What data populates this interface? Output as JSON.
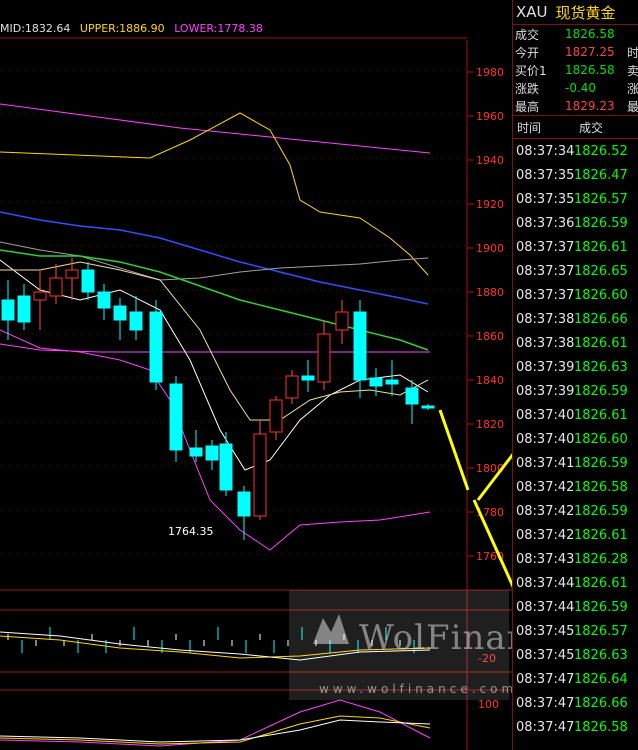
{
  "indicator": {
    "mid": "MID:1832.64",
    "upper": "UPPER:1886.90",
    "lower": "LOWER:1778.38",
    "colors": {
      "mid": "#e0e0e0",
      "upper": "#ffd700",
      "lower": "#ff40ff"
    }
  },
  "price_axis": {
    "ticks": [
      "1980",
      "1960",
      "1940",
      "1920",
      "1900",
      "1880",
      "1860",
      "1840",
      "1820",
      "1800",
      "1780",
      "1760"
    ],
    "color": "#ff3030"
  },
  "lower_axis": {
    "ticks": [
      "-20",
      "100"
    ]
  },
  "annotation": {
    "low_label": "1764.35"
  },
  "watermark": {
    "brand": "WolFinance",
    "url": "www.wolfinance.com"
  },
  "quote": {
    "code": "XAU",
    "name": "现货黄金",
    "rows": [
      {
        "label": "成交",
        "value": "1826.58",
        "color": "#00e000",
        "extra": ""
      },
      {
        "label": "今开",
        "value": "1827.25",
        "color": "#ff4040",
        "extra": "时"
      },
      {
        "label": "买价1",
        "value": "1826.58",
        "color": "#00e000",
        "extra": "卖"
      },
      {
        "label": "涨跌",
        "value": "-0.40",
        "color": "#00e000",
        "extra": "涨"
      },
      {
        "label": "最高",
        "value": "1829.23",
        "color": "#ff4040",
        "extra": "最"
      }
    ]
  },
  "ticks_header": {
    "time": "时间",
    "price": "成交"
  },
  "ticks": [
    {
      "time": "08:37:34",
      "price": "1826.52"
    },
    {
      "time": "08:37:35",
      "price": "1826.47"
    },
    {
      "time": "08:37:35",
      "price": "1826.57"
    },
    {
      "time": "08:37:36",
      "price": "1826.59"
    },
    {
      "time": "08:37:37",
      "price": "1826.61"
    },
    {
      "time": "08:37:37",
      "price": "1826.65"
    },
    {
      "time": "08:37:37",
      "price": "1826.60"
    },
    {
      "time": "08:37:38",
      "price": "1826.66"
    },
    {
      "time": "08:37:38",
      "price": "1826.61"
    },
    {
      "time": "08:37:39",
      "price": "1826.63"
    },
    {
      "time": "08:37:39",
      "price": "1826.59"
    },
    {
      "time": "08:37:40",
      "price": "1826.61"
    },
    {
      "time": "08:37:40",
      "price": "1826.60"
    },
    {
      "time": "08:37:41",
      "price": "1826.59"
    },
    {
      "time": "08:37:42",
      "price": "1826.58"
    },
    {
      "time": "08:37:42",
      "price": "1826.59"
    },
    {
      "time": "08:37:42",
      "price": "1826.61"
    },
    {
      "time": "08:37:43",
      "price": "1826.28"
    },
    {
      "time": "08:37:44",
      "price": "1826.61"
    },
    {
      "time": "08:37:44",
      "price": "1826.59"
    },
    {
      "time": "08:37:45",
      "price": "1826.57"
    },
    {
      "time": "08:37:45",
      "price": "1826.63"
    },
    {
      "time": "08:37:47",
      "price": "1826.64"
    },
    {
      "time": "08:37:47",
      "price": "1826.66"
    },
    {
      "time": "08:37:47",
      "price": "1826.58"
    }
  ]
}
